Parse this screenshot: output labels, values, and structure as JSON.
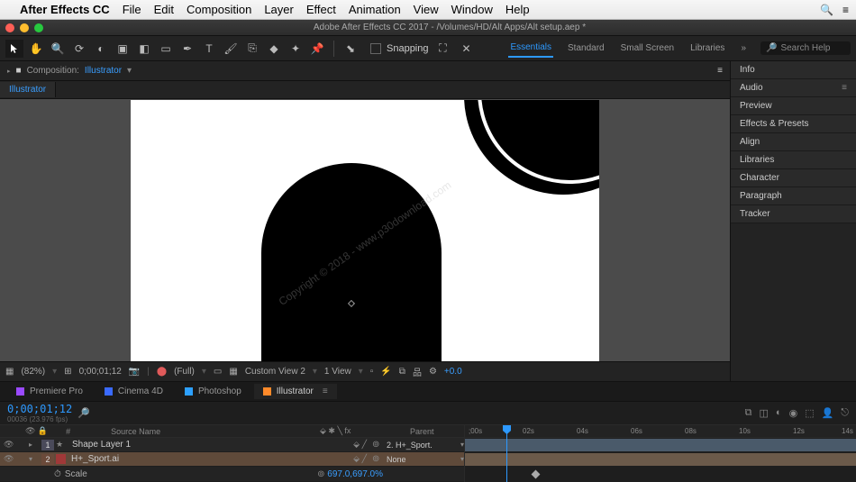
{
  "menubar": {
    "apple": "",
    "app": "After Effects CC",
    "items": [
      "File",
      "Edit",
      "Composition",
      "Layer",
      "Effect",
      "Animation",
      "View",
      "Window",
      "Help"
    ]
  },
  "window": {
    "title": "Adobe After Effects CC 2017 - /Volumes/HD/Alt Apps/Alt setup.aep *"
  },
  "toolbar": {
    "snapping_label": "Snapping"
  },
  "workspaces": {
    "tabs": [
      "Essentials",
      "Standard",
      "Small Screen",
      "Libraries"
    ],
    "active": 0,
    "search_placeholder": "Search Help"
  },
  "comp_panel": {
    "tab_prefix": "Composition:",
    "comp_name": "Illustrator",
    "active_tab": "Illustrator"
  },
  "viewer_footer": {
    "zoom": "(82%)",
    "timecode": "0;00;01;12",
    "res": "(Full)",
    "view_label": "Custom View 2",
    "views": "1 View",
    "exposure": "+0.0"
  },
  "side_panels": [
    "Info",
    "Audio",
    "Preview",
    "Effects & Presets",
    "Align",
    "Libraries",
    "Character",
    "Paragraph",
    "Tracker"
  ],
  "app_tabs": [
    {
      "label": "Premiere Pro",
      "color": "#9a4aff"
    },
    {
      "label": "Cinema 4D",
      "color": "#3a6aff"
    },
    {
      "label": "Photoshop",
      "color": "#2da0ff"
    },
    {
      "label": "Illustrator",
      "color": "#ff8a2a"
    }
  ],
  "app_tabs_active": 3,
  "timeline": {
    "current_time": "0;00;01;12",
    "frame_info": "00036 (23.976 fps)",
    "columns": {
      "num": "#",
      "source": "Source Name",
      "parent": "Parent"
    },
    "layers": [
      {
        "num": "1",
        "name": "Shape Layer 1",
        "type": "shape",
        "parent_label": "2. H+_Sport.",
        "sel": false,
        "color": "#4a4a9a"
      },
      {
        "num": "2",
        "name": "H+_Sport.ai",
        "type": "ai",
        "parent_label": "None",
        "sel": true,
        "color": "#6b4a3a"
      }
    ],
    "sub_prop": {
      "name": "Scale",
      "value": "697.0,697.0%"
    },
    "ruler_marks": [
      ";00s",
      "02s",
      "04s",
      "06s",
      "08s",
      "10s",
      "12s",
      "14s"
    ]
  },
  "watermark": "Copyright © 2018 - www.p30download.com"
}
